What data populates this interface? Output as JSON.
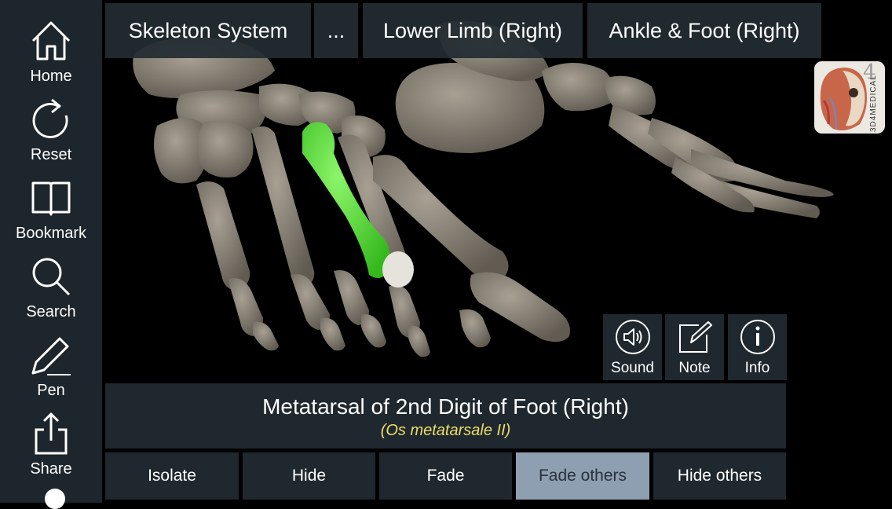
{
  "sidebar": {
    "items": [
      {
        "label": "Home",
        "icon": "home-icon"
      },
      {
        "label": "Reset",
        "icon": "reset-icon"
      },
      {
        "label": "Bookmark",
        "icon": "bookmark-icon"
      },
      {
        "label": "Search",
        "icon": "search-icon"
      },
      {
        "label": "Pen",
        "icon": "pen-icon"
      },
      {
        "label": "Share",
        "icon": "share-icon"
      }
    ]
  },
  "breadcrumb": {
    "items": [
      "Skeleton System",
      "...",
      "Lower Limb (Right)",
      "Ankle & Foot (Right)"
    ]
  },
  "logo": {
    "text": "3D4MEDICAL",
    "number": "4"
  },
  "tools": [
    {
      "label": "Sound",
      "icon": "speaker-icon"
    },
    {
      "label": "Note",
      "icon": "note-icon"
    },
    {
      "label": "Info",
      "icon": "info-icon"
    }
  ],
  "structure": {
    "name": "Metatarsal of 2nd Digit of Foot (Right)",
    "latin": "(Os metatarsale II)"
  },
  "actions": {
    "items": [
      "Isolate",
      "Hide",
      "Fade",
      "Fade others",
      "Hide others"
    ],
    "active": "Fade others"
  },
  "colors": {
    "sidebar_bg": "#1d262c",
    "panel_bg": "#1f282e",
    "bone": "#8d8679",
    "highlight": "#5fe03c",
    "latin_text": "#ecdc6a",
    "active_button": "#8d9fb1"
  }
}
